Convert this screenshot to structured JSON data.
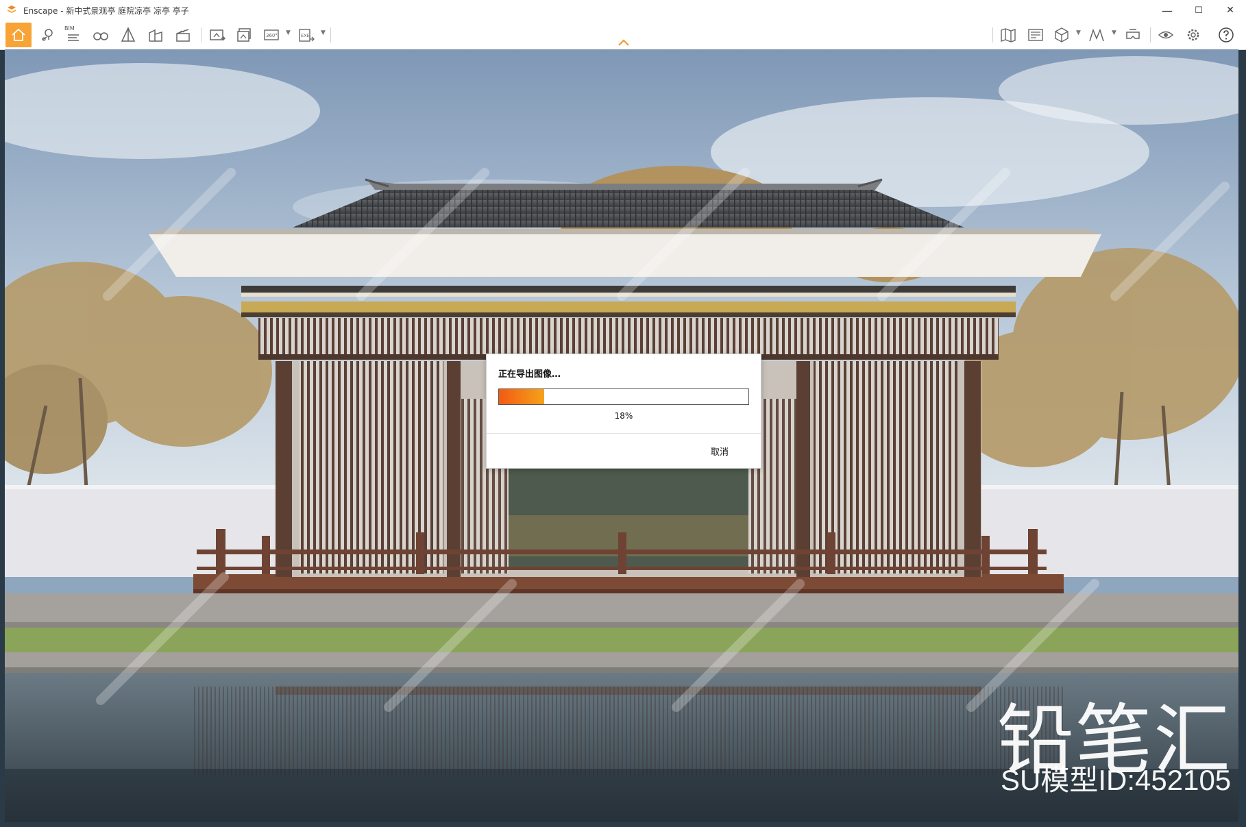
{
  "window": {
    "title": "Enscape - 新中式景观亭 庭院凉亭 凉亭 亭子",
    "controls": {
      "minimize": "—",
      "maximize": "☐",
      "close": "✕"
    }
  },
  "toolbar": {
    "bim_label": "BIM",
    "panorama_label": "360°",
    "exe_label": "EXE",
    "left_icons": [
      "home-icon",
      "location-pin-icon",
      "bim-info-icon",
      "binoculars-icon",
      "pyramid-icon",
      "buildings-icon",
      "clapperboard-icon",
      "screenshot-icon",
      "batch-render-icon",
      "panorama-icon",
      "export-exe-icon"
    ],
    "right_icons": [
      "map-icon",
      "view-management-icon",
      "cube-icon",
      "atmosphere-icon",
      "vr-headset-icon",
      "visual-settings-icon",
      "settings-gear-icon",
      "help-icon"
    ],
    "accent_color": "#f7a335"
  },
  "dialog": {
    "title": "正在导出图像…",
    "progress": 0.18,
    "progress_label": "18%",
    "cancel_label": "取消"
  },
  "watermark": {
    "brand": "铅笔汇",
    "model_id": "SU模型ID:452105"
  }
}
